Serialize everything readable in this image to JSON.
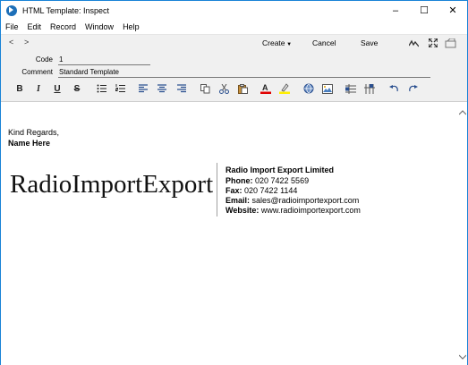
{
  "window": {
    "title": "HTML Template: Inspect",
    "controls": [
      "–",
      "☐",
      "✕"
    ]
  },
  "menu": [
    "File",
    "Edit",
    "Record",
    "Window",
    "Help"
  ],
  "toolbar": {
    "back": "<",
    "forward": ">",
    "create_label": "Create",
    "cancel_label": "Cancel",
    "save_label": "Save"
  },
  "fields": {
    "code_label": "Code",
    "code_value": "1",
    "comment_label": "Comment",
    "comment_value": "Standard Template"
  },
  "format_bar": {
    "bold": "B",
    "italic": "I",
    "underline": "U",
    "strike": "S"
  },
  "content": {
    "greeting": "Kind Regards,",
    "name": "Name Here",
    "logo_text": "RadioImportExport",
    "company": "Radio Import Export Limited",
    "phone_label": "Phone:",
    "phone_value": "020 7422 5569",
    "fax_label": "Fax:",
    "fax_value": "020 7422 1144",
    "email_label": "Email:",
    "email_value": "sales@radioimportexport.com",
    "website_label": "Website:",
    "website_value": "www.radioimportexport.com"
  },
  "colors": {
    "window_border": "#1883d7",
    "text_color_underline": "#e00000",
    "highlight_color": "#ffef00"
  }
}
